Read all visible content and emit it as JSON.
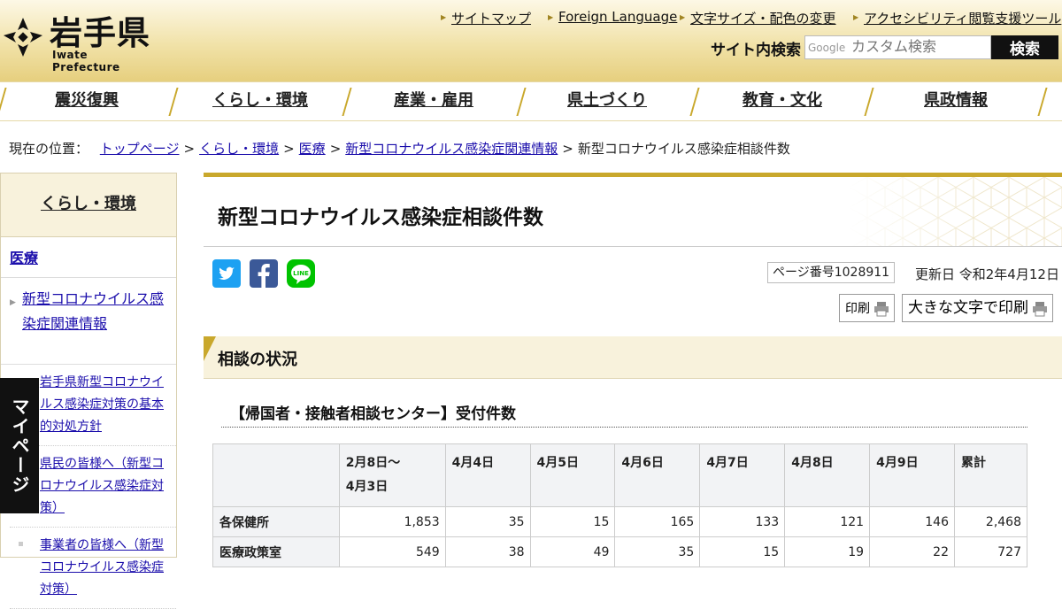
{
  "header": {
    "logo_jp": "岩手県",
    "logo_en": "Iwate Prefecture",
    "util_links": [
      "サイトマップ",
      "Foreign Language",
      "文字サイズ・配色の変更",
      "アクセシビリティ閲覧支援ツール"
    ],
    "search_label": "サイト内検索",
    "search_brand": "Google",
    "search_placeholder": "カスタム検索",
    "search_button": "検索"
  },
  "global_nav": [
    "震災復興",
    "くらし・環境",
    "産業・雇用",
    "県土づくり",
    "教育・文化",
    "県政情報"
  ],
  "breadcrumb": {
    "prefix": "現在の位置：",
    "links": [
      "トップページ",
      "くらし・環境",
      "医療",
      "新型コロナウイルス感染症関連情報"
    ],
    "current": "新型コロナウイルス感染症相談件数",
    "separator": ">"
  },
  "sidebar": {
    "heading": "くらし・環境",
    "level1": "医療",
    "level2": "新型コロナウイルス感染症関連情報",
    "items": [
      "岩手県新型コロナウイルス感染症対策の基本的対処方針",
      "県民の皆様へ（新型コロナウイルス感染症対策）",
      "事業者の皆様へ（新型コロナウイルス感染症対策）"
    ],
    "mypage": "マイページ"
  },
  "main": {
    "title": "新型コロナウイルス感染症相談件数",
    "page_number": "ページ番号1028911",
    "update_date": "更新日 令和2年4月12日",
    "print": "印刷",
    "large_print": "大きな文字で印刷",
    "section_heading": "相談の状況",
    "sub_heading": "【帰国者・接触者相談センター】受付件数"
  },
  "table": {
    "headers": [
      "",
      "2月8日～\n4月3日",
      "4月4日",
      "4月5日",
      "4月6日",
      "4月7日",
      "4月8日",
      "4月9日",
      "累計"
    ],
    "rows": [
      {
        "label": "各保健所",
        "values": [
          "1,853",
          "35",
          "15",
          "165",
          "133",
          "121",
          "146",
          "2,468"
        ]
      },
      {
        "label": "医療政策室",
        "values": [
          "549",
          "38",
          "49",
          "35",
          "15",
          "19",
          "22",
          "727"
        ]
      }
    ]
  },
  "colors": {
    "accent_gold": "#c9a82c",
    "header_bg": "#f1e2a8",
    "twitter": "#1da1f2",
    "facebook": "#3b5998",
    "line": "#00c300"
  },
  "icons": [
    "iwate-emblem-icon",
    "twitter-icon",
    "facebook-icon",
    "line-icon",
    "printer-icon"
  ]
}
